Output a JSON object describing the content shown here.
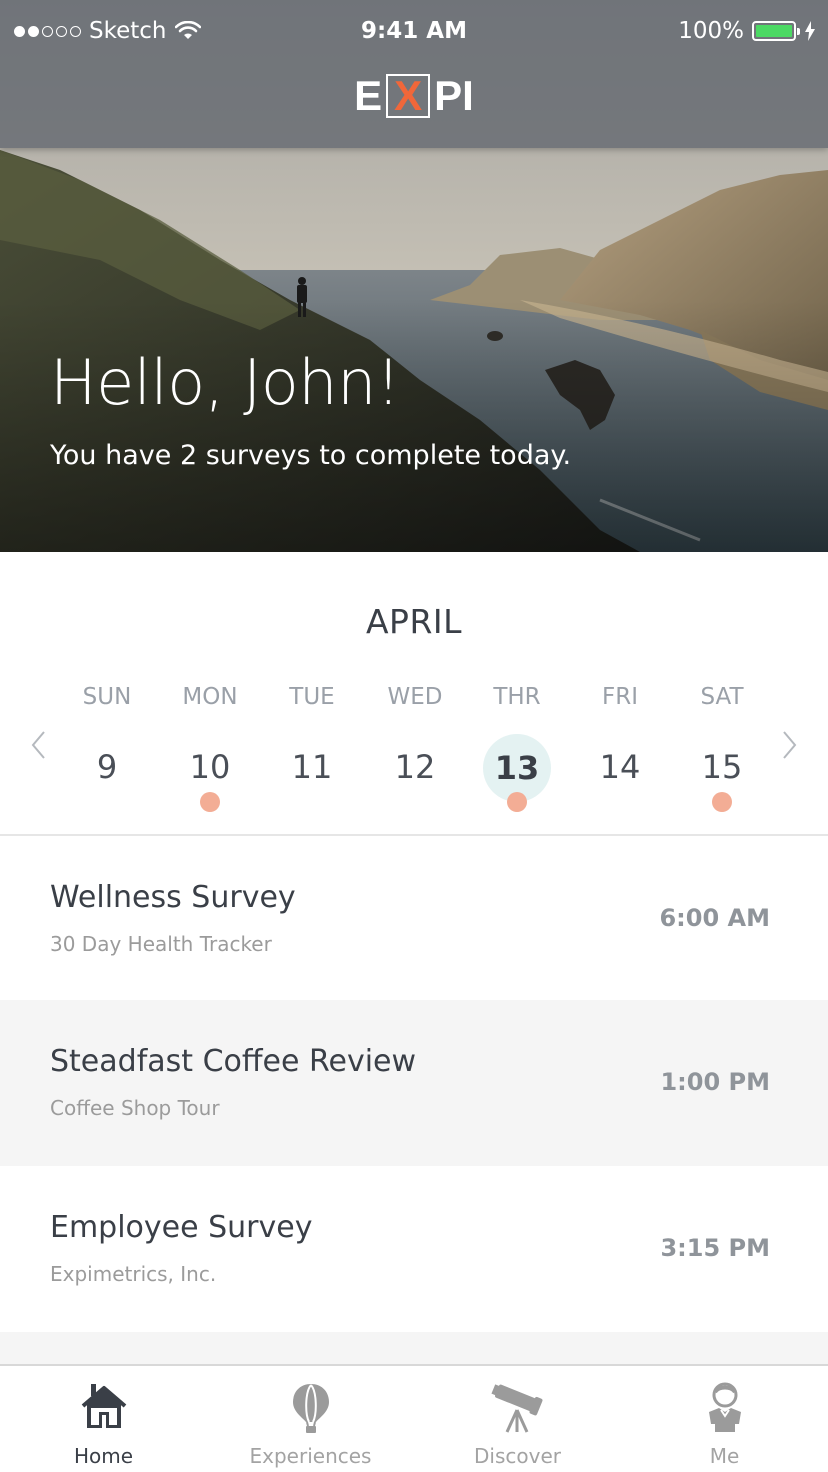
{
  "status_bar": {
    "carrier": "Sketch",
    "time": "9:41 AM",
    "battery": "100%",
    "signal_bars": 2,
    "icons": [
      "wifi-icon",
      "battery-icon",
      "charging-bolt-icon"
    ]
  },
  "brand": {
    "logo_letters": [
      "E",
      "X",
      "PI"
    ],
    "accent_color": "#f0673a"
  },
  "hero": {
    "greeting": "Hello, John!",
    "subtitle": "You have 2 surveys to complete today."
  },
  "calendar": {
    "month": "APRIL",
    "prev_icon": "chevron-left-icon",
    "next_icon": "chevron-right-icon",
    "days": [
      {
        "name": "SUN",
        "number": "9",
        "selected": false,
        "has_event": false
      },
      {
        "name": "MON",
        "number": "10",
        "selected": false,
        "has_event": true
      },
      {
        "name": "TUE",
        "number": "11",
        "selected": false,
        "has_event": false
      },
      {
        "name": "WED",
        "number": "12",
        "selected": false,
        "has_event": false
      },
      {
        "name": "THR",
        "number": "13",
        "selected": true,
        "has_event": true
      },
      {
        "name": "FRI",
        "number": "14",
        "selected": false,
        "has_event": false
      },
      {
        "name": "SAT",
        "number": "15",
        "selected": false,
        "has_event": true
      }
    ],
    "event_color": "#f3ad95",
    "selected_color": "#e4f2f2"
  },
  "surveys": [
    {
      "title": "Wellness Survey",
      "subtitle": "30 Day Health Tracker",
      "time": "6:00 AM"
    },
    {
      "title": "Steadfast Coffee Review",
      "subtitle": "Coffee Shop Tour",
      "time": "1:00 PM"
    },
    {
      "title": "Employee Survey",
      "subtitle": "Expimetrics, Inc.",
      "time": "3:15 PM"
    }
  ],
  "tabbar": {
    "active": "Home",
    "tabs": [
      {
        "label": "Home",
        "icon": "house-icon"
      },
      {
        "label": "Experiences",
        "icon": "hot-air-balloon-icon"
      },
      {
        "label": "Discover",
        "icon": "telescope-icon"
      },
      {
        "label": "Me",
        "icon": "user-avatar-icon"
      }
    ]
  }
}
